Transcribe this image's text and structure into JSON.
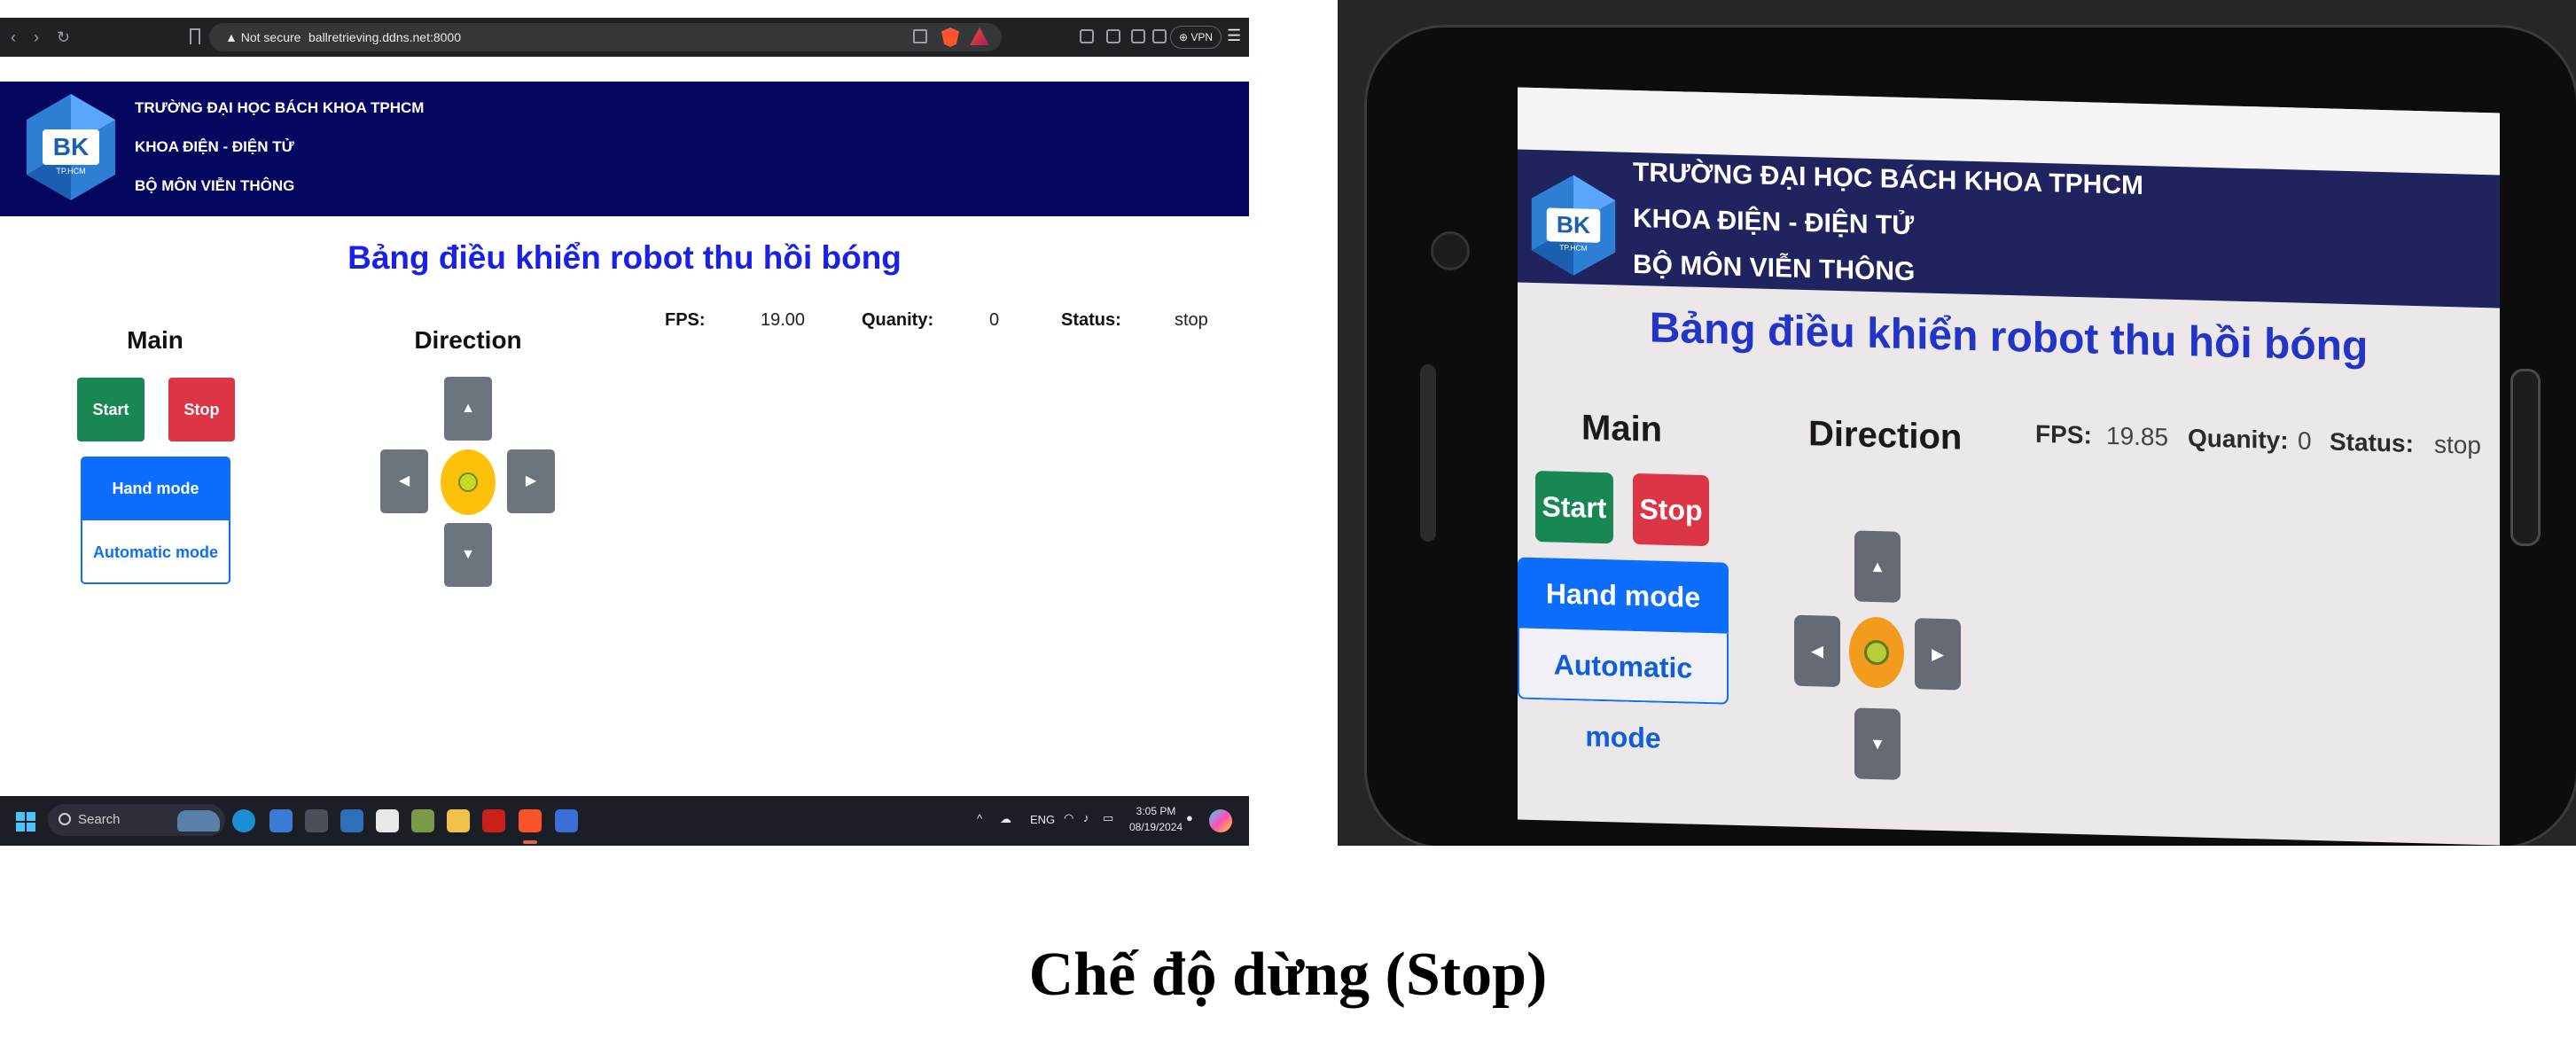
{
  "browser": {
    "back_icon": "chevron-left-icon",
    "forward_icon": "chevron-right-icon",
    "reload_icon": "reload-icon",
    "security_label": "▲ Not secure",
    "url": "ballretrieving.ddns.net:8000",
    "vpn_label": "⊕ VPN"
  },
  "desktop_page": {
    "header": {
      "logo_text": "BK",
      "logo_subtext": "TP.HCM",
      "line1": "TRƯỜNG ĐẠI HỌC BÁCH KHOA TPHCM",
      "line2": "KHOA ĐIỆN - ĐIỆN TỬ",
      "line3": "BỘ MÔN VIỄN THÔNG"
    },
    "title": "Bảng điều khiển robot thu hồi bóng",
    "main_section": {
      "title": "Main",
      "start_label": "Start",
      "stop_label": "Stop",
      "hand_mode_label": "Hand mode",
      "auto_mode_label": "Automatic mode"
    },
    "direction_section": {
      "title": "Direction",
      "up_icon": "▲",
      "down_icon": "▼",
      "left_icon": "◀",
      "right_icon": "▶",
      "center_icon": "tennis-ball-icon"
    },
    "stats": {
      "fps_label": "FPS:",
      "fps_value": "19.00",
      "quantity_label": "Quanity:",
      "quantity_value": "0",
      "status_label": "Status:",
      "status_value": "stop"
    }
  },
  "taskbar": {
    "search_placeholder": "Search",
    "tray_lang": "ENG",
    "time": "3:05 PM",
    "date": "08/19/2024"
  },
  "phone_page": {
    "header": {
      "logo_text": "BK",
      "logo_subtext": "TP.HCM",
      "line1": "TRƯỜNG ĐẠI HỌC BÁCH KHOA TPHCM",
      "line2": "KHOA ĐIỆN - ĐIỆN TỬ",
      "line3": "BỘ MÔN VIỄN THÔNG"
    },
    "title": "Bảng điều khiển robot thu hồi bóng",
    "main_title": "Main",
    "direction_title": "Direction",
    "start_label": "Start",
    "stop_label": "Stop",
    "hand_mode_label": "Hand mode",
    "auto_mode_label": "Automatic mode",
    "fps_label": "FPS:",
    "fps_value": "19.85",
    "quantity_label": "Quanity:",
    "quantity_value": "0",
    "status_label": "Status:",
    "status_value": "stop"
  },
  "caption": "Chế độ dừng (Stop)",
  "colors": {
    "header_bg": "#040660",
    "title_blue": "#1a21e6",
    "start_green": "#198754",
    "stop_red": "#dc3545",
    "mode_blue": "#0d6efd",
    "dpad_gray": "#6c757d",
    "ball_yellow": "#ffc107"
  }
}
